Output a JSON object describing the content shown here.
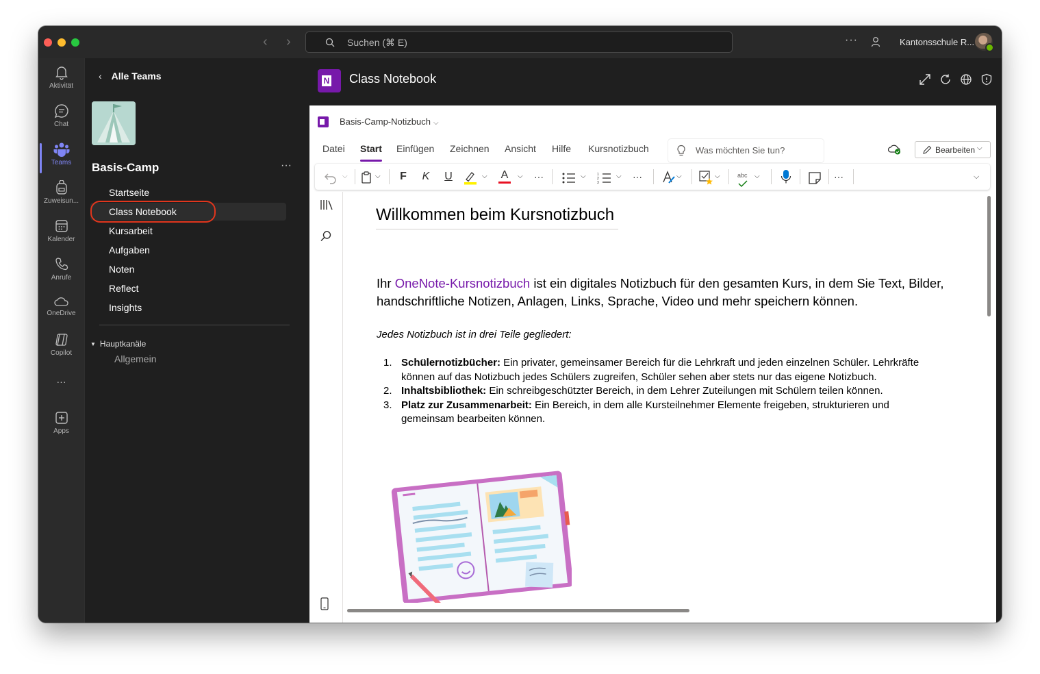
{
  "titlebar": {
    "search_placeholder": "Suchen (⌘ E)",
    "more": "···",
    "org_name": "Kantonsschule R..."
  },
  "appbar": {
    "items": [
      {
        "label": "Aktivität",
        "icon": "bell-icon"
      },
      {
        "label": "Chat",
        "icon": "chat-icon"
      },
      {
        "label": "Teams",
        "icon": "teams-icon"
      },
      {
        "label": "Zuweisun...",
        "icon": "backpack-icon"
      },
      {
        "label": "Kalender",
        "icon": "calendar-icon"
      },
      {
        "label": "Anrufe",
        "icon": "phone-icon"
      },
      {
        "label": "OneDrive",
        "icon": "cloud-icon"
      },
      {
        "label": "Copilot",
        "icon": "copilot-icon"
      },
      {
        "label": "Apps",
        "icon": "add-app-icon"
      }
    ],
    "more": "···",
    "active": "Teams",
    "accent": "#7f85f5"
  },
  "teampanel": {
    "back_label": "Alle Teams",
    "team_name": "Basis-Camp",
    "more": "···",
    "channels": [
      "Startseite",
      "Class Notebook",
      "Kursarbeit",
      "Aufgaben",
      "Noten",
      "Reflect",
      "Insights"
    ],
    "selected": "Class Notebook",
    "highlight_color": "#e2361d",
    "section": "Hauptkanäle",
    "subchannels": [
      "Allgemein"
    ]
  },
  "main": {
    "title": "Class Notebook",
    "app_color": "#7719aa"
  },
  "onenote": {
    "notebook_name": "Basis-Camp-Notizbuch",
    "tabs": [
      "Datei",
      "Start",
      "Einfügen",
      "Zeichnen",
      "Ansicht",
      "Hilfe",
      "Kursnotizbuch"
    ],
    "active_tab": "Start",
    "tellme_placeholder": "Was möchten Sie tun?",
    "edit_label": "Bearbeiten",
    "ribbon": {
      "bold": "F",
      "italic": "K",
      "underline": "U",
      "font_color": "A",
      "more": "···",
      "spelling": "abc"
    },
    "page": {
      "title": "Willkommen beim Kursnotizbuch",
      "intro_prefix": "Ihr ",
      "intro_link": "OneNote-Kursnotizbuch",
      "intro_rest": " ist ein digitales Notizbuch für den gesamten Kurs, in dem Sie Text, Bilder, handschriftliche Notizen, Anlagen, Links, Sprache, Video und mehr speichern können.",
      "subhead": "Jedes Notizbuch ist in drei Teile gegliedert:",
      "items": [
        {
          "num": "1.",
          "bold": "Schülernotizbücher:",
          "text": " Ein privater, gemeinsamer Bereich für die Lehrkraft und jeden einzelnen Schüler. Lehrkräfte können auf das Notizbuch jedes Schülers zugreifen, Schüler sehen aber stets nur das eigene Notizbuch."
        },
        {
          "num": "2.",
          "bold": "Inhaltsbibliothek:",
          "text": " Ein schreibgeschützter Bereich, in dem Lehrer Zuteilungen mit Schülern teilen können."
        },
        {
          "num": "3.",
          "bold": "Platz zur Zusammenarbeit:",
          "text": " Ein Bereich, in dem alle Kursteilnehmer Elemente freigeben, strukturieren und gemeinsam bearbeiten können."
        }
      ]
    }
  }
}
